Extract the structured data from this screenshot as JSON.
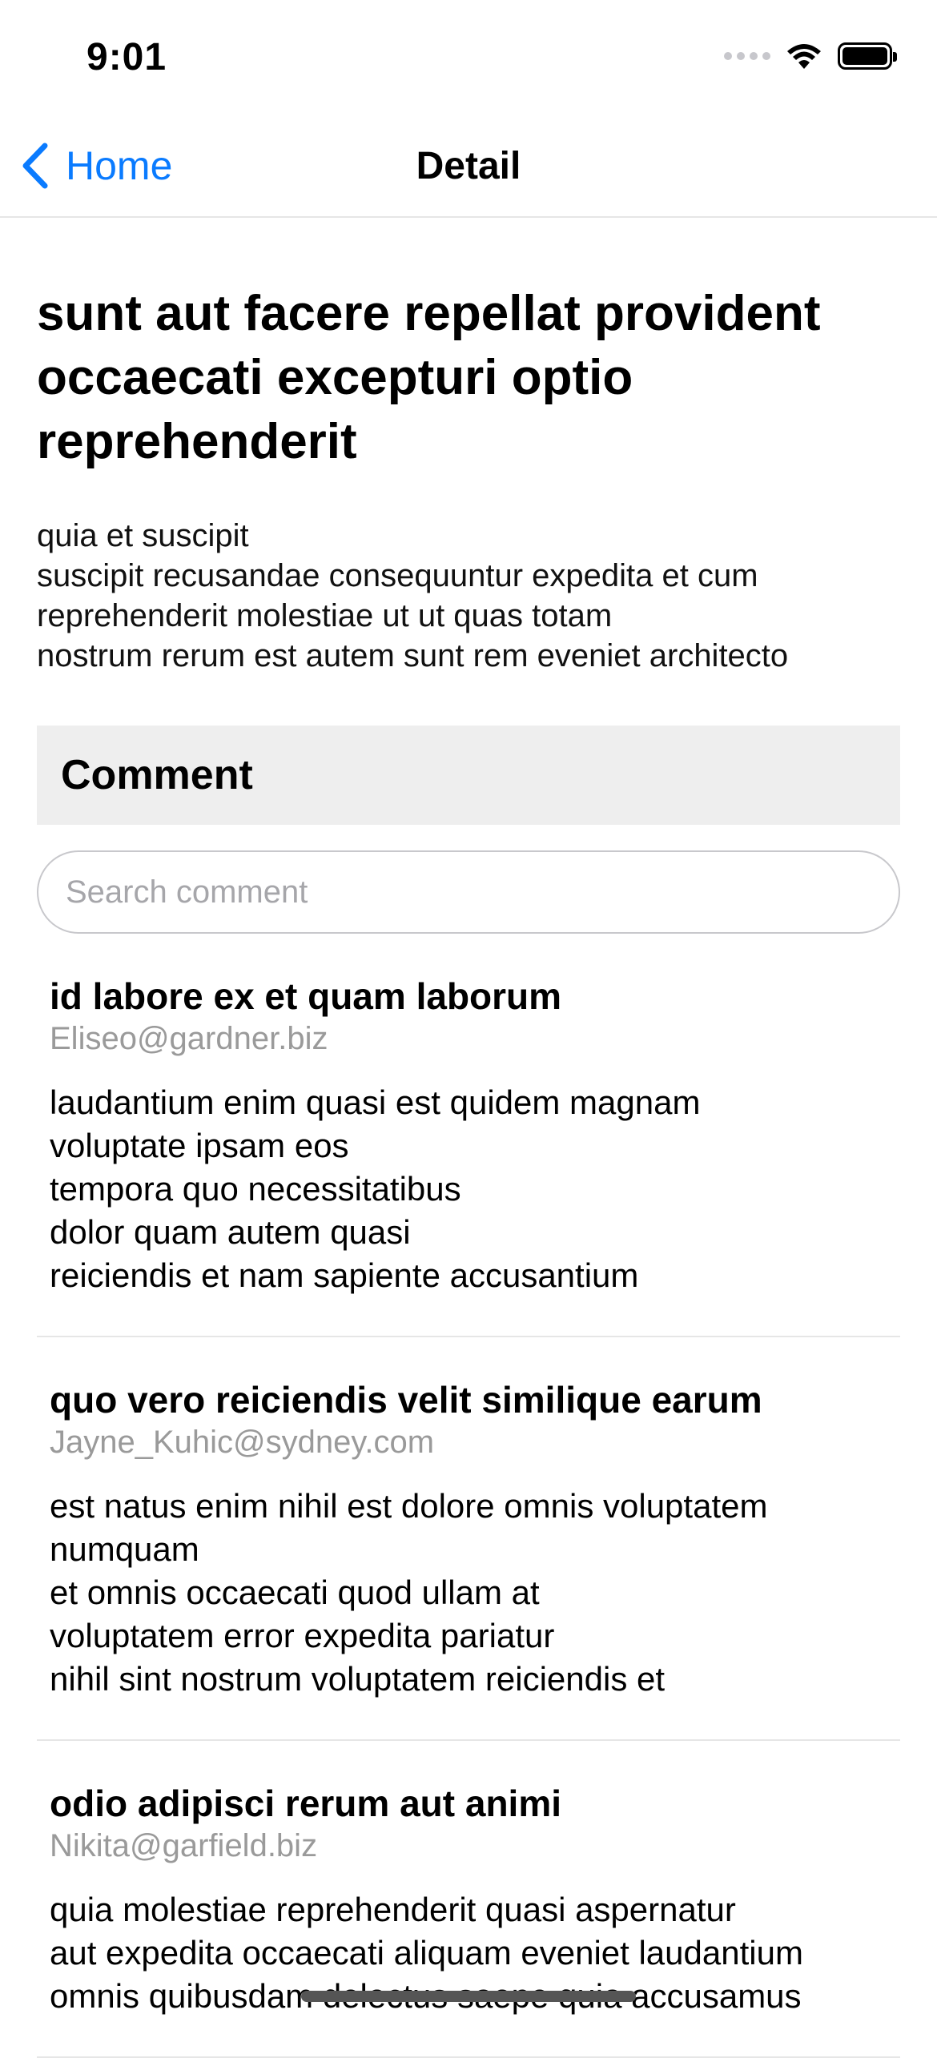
{
  "status_bar": {
    "time": "9:01"
  },
  "nav": {
    "back_label": "Home",
    "title": "Detail"
  },
  "post": {
    "title": "sunt aut facere repellat provident occaecati excepturi optio reprehenderit",
    "body": "quia et suscipit\nsuscipit recusandae consequuntur expedita et cum\nreprehenderit molestiae ut ut quas totam\nnostrum rerum est autem sunt rem eveniet architecto"
  },
  "comments_section": {
    "header": "Comment",
    "search_placeholder": "Search comment",
    "search_value": ""
  },
  "comments": [
    {
      "name": "id labore ex et quam laborum",
      "email": "Eliseo@gardner.biz",
      "body": "laudantium enim quasi est quidem magnam\nvoluptate ipsam eos\ntempora quo necessitatibus\ndolor quam autem quasi\nreiciendis et nam sapiente accusantium"
    },
    {
      "name": "quo vero reiciendis velit similique earum",
      "email": "Jayne_Kuhic@sydney.com",
      "body": "est natus enim nihil est dolore omnis voluptatem\nnumquam\net omnis occaecati quod ullam at\nvoluptatem error expedita pariatur\nnihil sint nostrum voluptatem reiciendis et"
    },
    {
      "name": "odio adipisci rerum aut animi",
      "email": "Nikita@garfield.biz",
      "body": "quia molestiae reprehenderit quasi aspernatur\naut expedita occaecati aliquam eveniet laudantium\nomnis quibusdam delectus saepe quia accusamus"
    }
  ]
}
